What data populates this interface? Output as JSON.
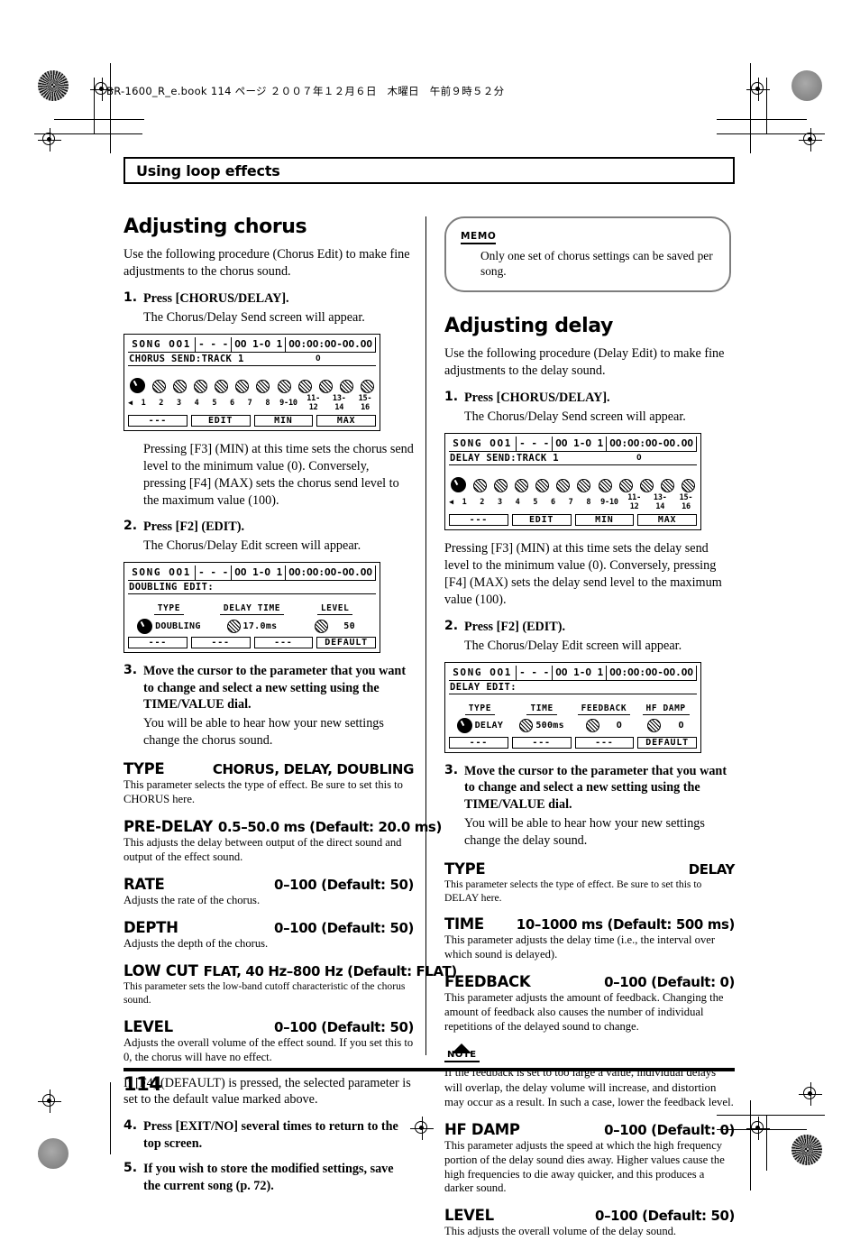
{
  "print_header": "BR-1600_R_e.book  114 ページ  ２００７年１２月６日　木曜日　午前９時５２分",
  "banner": {
    "label": "Using loop effects"
  },
  "page_number": "114",
  "left_column": {
    "heading": "Adjusting chorus",
    "intro": "Use the following procedure (Chorus Edit) to make fine adjustments to the chorus sound.",
    "step1": {
      "num": "1.",
      "title": "Press [CHORUS/DELAY].",
      "sub": "The Chorus/Delay Send screen will appear.",
      "after": "Pressing [F3] (MIN) at this time sets the chorus send level to the minimum value (0). Conversely, pressing [F4] (MAX) sets the chorus send level to the maximum value (100)."
    },
    "step2": {
      "num": "2.",
      "title": "Press [F2] (EDIT).",
      "sub": "The Chorus/Delay Edit screen will appear."
    },
    "step3": {
      "num": "3.",
      "title": "Move the cursor to the parameter that you want to change and select a new setting using the TIME/VALUE dial.",
      "sub": "You will be able to hear how your new settings change the chorus sound."
    },
    "step4": {
      "num": "4.",
      "title": "Press [EXIT/NO] several times to return to the top screen."
    },
    "step5": {
      "num": "5.",
      "title": "If you wish to store the modified settings, save the current song (p. 72)."
    },
    "default_note": "If [F4] (DEFAULT) is pressed, the selected parameter is set to the default value marked above.",
    "params": [
      {
        "name": "TYPE",
        "value": "CHORUS, DELAY, DOUBLING",
        "desc": "This parameter selects the type of effect. Be sure to set this to CHORUS here."
      },
      {
        "name": "PRE-DELAY",
        "value": "0.5–50.0 ms (Default: 20.0 ms)",
        "desc": "This adjusts the delay between output of the direct sound and output of the effect sound."
      },
      {
        "name": "RATE",
        "value": "0–100 (Default: 50)",
        "desc": "Adjusts the rate of the chorus."
      },
      {
        "name": "DEPTH",
        "value": "0–100 (Default: 50)",
        "desc": "Adjusts the depth of the chorus."
      },
      {
        "name": "LOW CUT",
        "value": "FLAT, 40 Hz–800 Hz (Default: FLAT)",
        "desc": "This parameter sets the low-band cutoff characteristic of the chorus sound."
      },
      {
        "name": "LEVEL",
        "value": "0–100 (Default: 50)",
        "desc": "Adjusts the overall volume of the effect sound. If you set this to 0, the chorus will have no effect."
      }
    ],
    "lcd_send": {
      "song": "SONG OO1",
      "seg_dashes": "- - -",
      "seg_measure": "OO 1-O 1",
      "seg_time": "OO:OO:OO-OO.OO",
      "title": "CHORUS SEND:TRACK 1",
      "title_mark": "O",
      "track_labels": [
        "1",
        "2",
        "3",
        "4",
        "5",
        "6",
        "7",
        "8",
        "9-10",
        "11-12",
        "13-14",
        "15-16"
      ],
      "fkeys": [
        "---",
        "EDIT",
        "MIN",
        "MAX"
      ]
    },
    "lcd_edit": {
      "song": "SONG OO1",
      "seg_dashes": "- - -",
      "seg_measure": "OO 1-O 1",
      "seg_time": "OO:OO:OO-OO.OO",
      "title": "DOUBLING EDIT:",
      "cells": [
        {
          "head": "TYPE",
          "value": "DOUBLING"
        },
        {
          "head": "DELAY TIME",
          "value": "17.0ms"
        },
        {
          "head": "LEVEL",
          "value": "50"
        }
      ],
      "fkeys": [
        "---",
        "---",
        "---",
        "DEFAULT"
      ]
    }
  },
  "right_column": {
    "memo": {
      "tag": "MEMO",
      "text": "Only one set of chorus settings can be saved per song."
    },
    "heading": "Adjusting delay",
    "intro": "Use the following procedure (Delay Edit) to make fine adjustments to the delay sound.",
    "step1": {
      "num": "1.",
      "title": "Press [CHORUS/DELAY].",
      "sub": "The Chorus/Delay Send screen will appear.",
      "after": "Pressing [F3] (MIN) at this time sets the delay send level to the minimum value (0). Conversely, pressing [F4] (MAX) sets the delay send level to the maximum value (100)."
    },
    "step2": {
      "num": "2.",
      "title": "Press [F2] (EDIT).",
      "sub": "The Chorus/Delay Edit screen will appear."
    },
    "step3": {
      "num": "3.",
      "title": "Move the cursor to the parameter that you want to change and select a new setting using the TIME/VALUE dial.",
      "sub": "You will be able to hear how your new settings change the delay sound."
    },
    "note": {
      "tag": "NOTE",
      "text": "If the feedback is set to too large a value, individual delays will overlap, the delay volume will increase, and distortion may occur as a result. In such a case, lower the feedback level."
    },
    "params": [
      {
        "name": "TYPE",
        "value": "DELAY",
        "desc": "This parameter selects the type of effect. Be sure to set this to DELAY here."
      },
      {
        "name": "TIME",
        "value": "10–1000 ms (Default: 500 ms)",
        "desc": "This parameter adjusts the delay time (i.e., the interval over which sound is delayed)."
      },
      {
        "name": "FEEDBACK",
        "value": "0–100 (Default: 0)",
        "desc": "This parameter adjusts the amount of feedback. Changing the amount of feedback also causes the number of individual repetitions of the delayed sound to change."
      },
      {
        "name": "HF DAMP",
        "value": "0–100 (Default: 0)",
        "desc": "This parameter adjusts the speed at which the high frequency portion of the delay sound dies away. Higher values cause the high frequencies to die away quicker, and this produces a darker sound."
      },
      {
        "name": "LEVEL",
        "value": "0–100 (Default: 50)",
        "desc": "This adjusts the overall volume of the delay sound."
      }
    ],
    "lcd_send": {
      "song": "SONG OO1",
      "seg_dashes": "- - -",
      "seg_measure": "OO 1-O 1",
      "seg_time": "OO:OO:OO-OO.OO",
      "title": "DELAY SEND:TRACK 1",
      "title_mark": "O",
      "track_labels": [
        "1",
        "2",
        "3",
        "4",
        "5",
        "6",
        "7",
        "8",
        "9-10",
        "11-12",
        "13-14",
        "15-16"
      ],
      "fkeys": [
        "---",
        "EDIT",
        "MIN",
        "MAX"
      ]
    },
    "lcd_edit": {
      "song": "SONG OO1",
      "seg_dashes": "- - -",
      "seg_measure": "OO 1-O 1",
      "seg_time": "OO:OO:OO-OO.OO",
      "title": "DELAY EDIT:",
      "cells": [
        {
          "head": "TYPE",
          "value": "DELAY"
        },
        {
          "head": "TIME",
          "value": "500ms"
        },
        {
          "head": "FEEDBACK",
          "value": "O"
        },
        {
          "head": "HF DAMP",
          "value": "O"
        }
      ],
      "fkeys": [
        "---",
        "---",
        "---",
        "DEFAULT"
      ]
    }
  }
}
